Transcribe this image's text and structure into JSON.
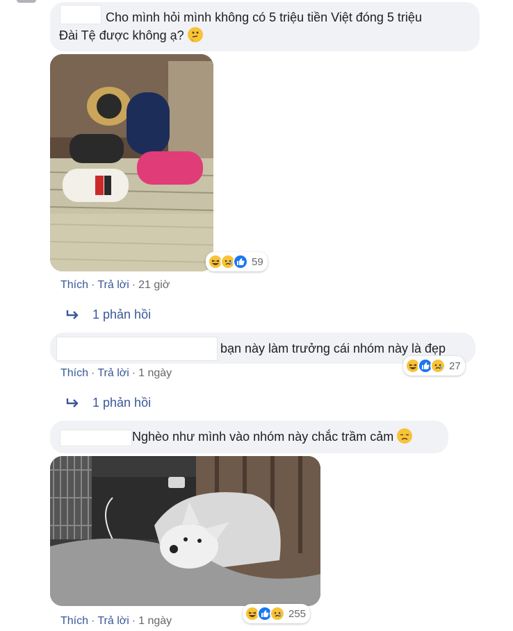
{
  "comments": [
    {
      "text_line1": "Cho mình hỏi mình không có 5 triệu tiền Việt đóng 5 triệu",
      "text_line2": "Đài Tệ được không ạ?",
      "emoji": "thinking-face-icon",
      "reactions": [
        "haha",
        "sad",
        "like"
      ],
      "reaction_count": "59",
      "like_label": "Thích",
      "reply_label": "Trả lời",
      "separator": "·",
      "time": "21 giờ",
      "replies_label": "1 phản hồi"
    },
    {
      "text": "bạn này làm trưởng cái nhóm này là đẹp",
      "reactions": [
        "haha",
        "like",
        "sad"
      ],
      "reaction_count": "27",
      "like_label": "Thích",
      "reply_label": "Trả lời",
      "separator": "·",
      "time": "1 ngày",
      "replies_label": "1 phản hồi"
    },
    {
      "text": "Nghèo như mình vào nhóm này chắc trầm cảm",
      "emoji": "disappointed-face-icon",
      "reactions": [
        "haha",
        "like",
        "sad"
      ],
      "reaction_count": "255",
      "like_label": "Thích",
      "reply_label": "Trả lời",
      "separator": "·",
      "time": "1 ngày"
    }
  ],
  "colors": {
    "bubble": "#f0f2f5",
    "link": "#385898",
    "meta": "#65676b",
    "like": "#1877f2",
    "emoji_yellow": "#f7c338"
  }
}
